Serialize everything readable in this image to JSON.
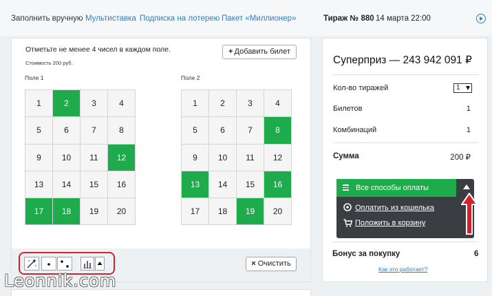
{
  "nav": {
    "tabs": [
      {
        "label": "Заполнить вручную",
        "active": true
      },
      {
        "label": "Мультиставка",
        "active": false
      },
      {
        "label": "Подписка на лотерею",
        "active": false
      },
      {
        "label": "Пакет «Миллионер»",
        "active": false
      }
    ],
    "draw_number": "Тираж № 880",
    "draw_date": "14 марта 22:00",
    "play_icon": "play-circle-icon"
  },
  "ticket": {
    "instruction": "Отметьте не менее 4 чисел в каждом поле.",
    "cost": "Стоимость 200 руб.",
    "add_ticket_label": "Добавить билет",
    "fields": [
      {
        "label": "Поле 1",
        "numbers": [
          1,
          2,
          3,
          4,
          5,
          6,
          7,
          8,
          9,
          10,
          11,
          12,
          13,
          14,
          15,
          16,
          17,
          18,
          19,
          20
        ],
        "selected": [
          2,
          12,
          17,
          18
        ]
      },
      {
        "label": "Поле 2",
        "numbers": [
          1,
          2,
          3,
          4,
          5,
          6,
          7,
          8,
          9,
          10,
          11,
          12,
          13,
          14,
          15,
          16,
          17,
          18,
          19,
          20
        ],
        "selected": [
          8,
          13,
          16,
          19
        ]
      }
    ],
    "tools": [
      "magic-wand-icon",
      "single-dot-icon",
      "two-dots-icon",
      "bar-chart-icon",
      "caret-up-icon"
    ],
    "clear_label": "Очистить",
    "accent_color": "#1dab4b"
  },
  "summary": {
    "superprize_label": "Суперприз —",
    "superprize_value": "243 942 091 ₽",
    "draws_label": "Кол-во тиражей",
    "draws_value": "1",
    "tickets_label": "Билетов",
    "tickets_value": "1",
    "combos_label": "Комбинаций",
    "combos_value": "1",
    "sum_label": "Сумма",
    "sum_value": "200 ₽",
    "pay_all_label": "Все способы оплаты",
    "pay_wallet_label": "Оплатить из кошелька",
    "pay_cart_label": "Положить в корзину",
    "bonus_label": "Бонус за покупку",
    "bonus_value": "6",
    "how_link": "Как это работает?"
  },
  "watermark": "Leonnik.com"
}
